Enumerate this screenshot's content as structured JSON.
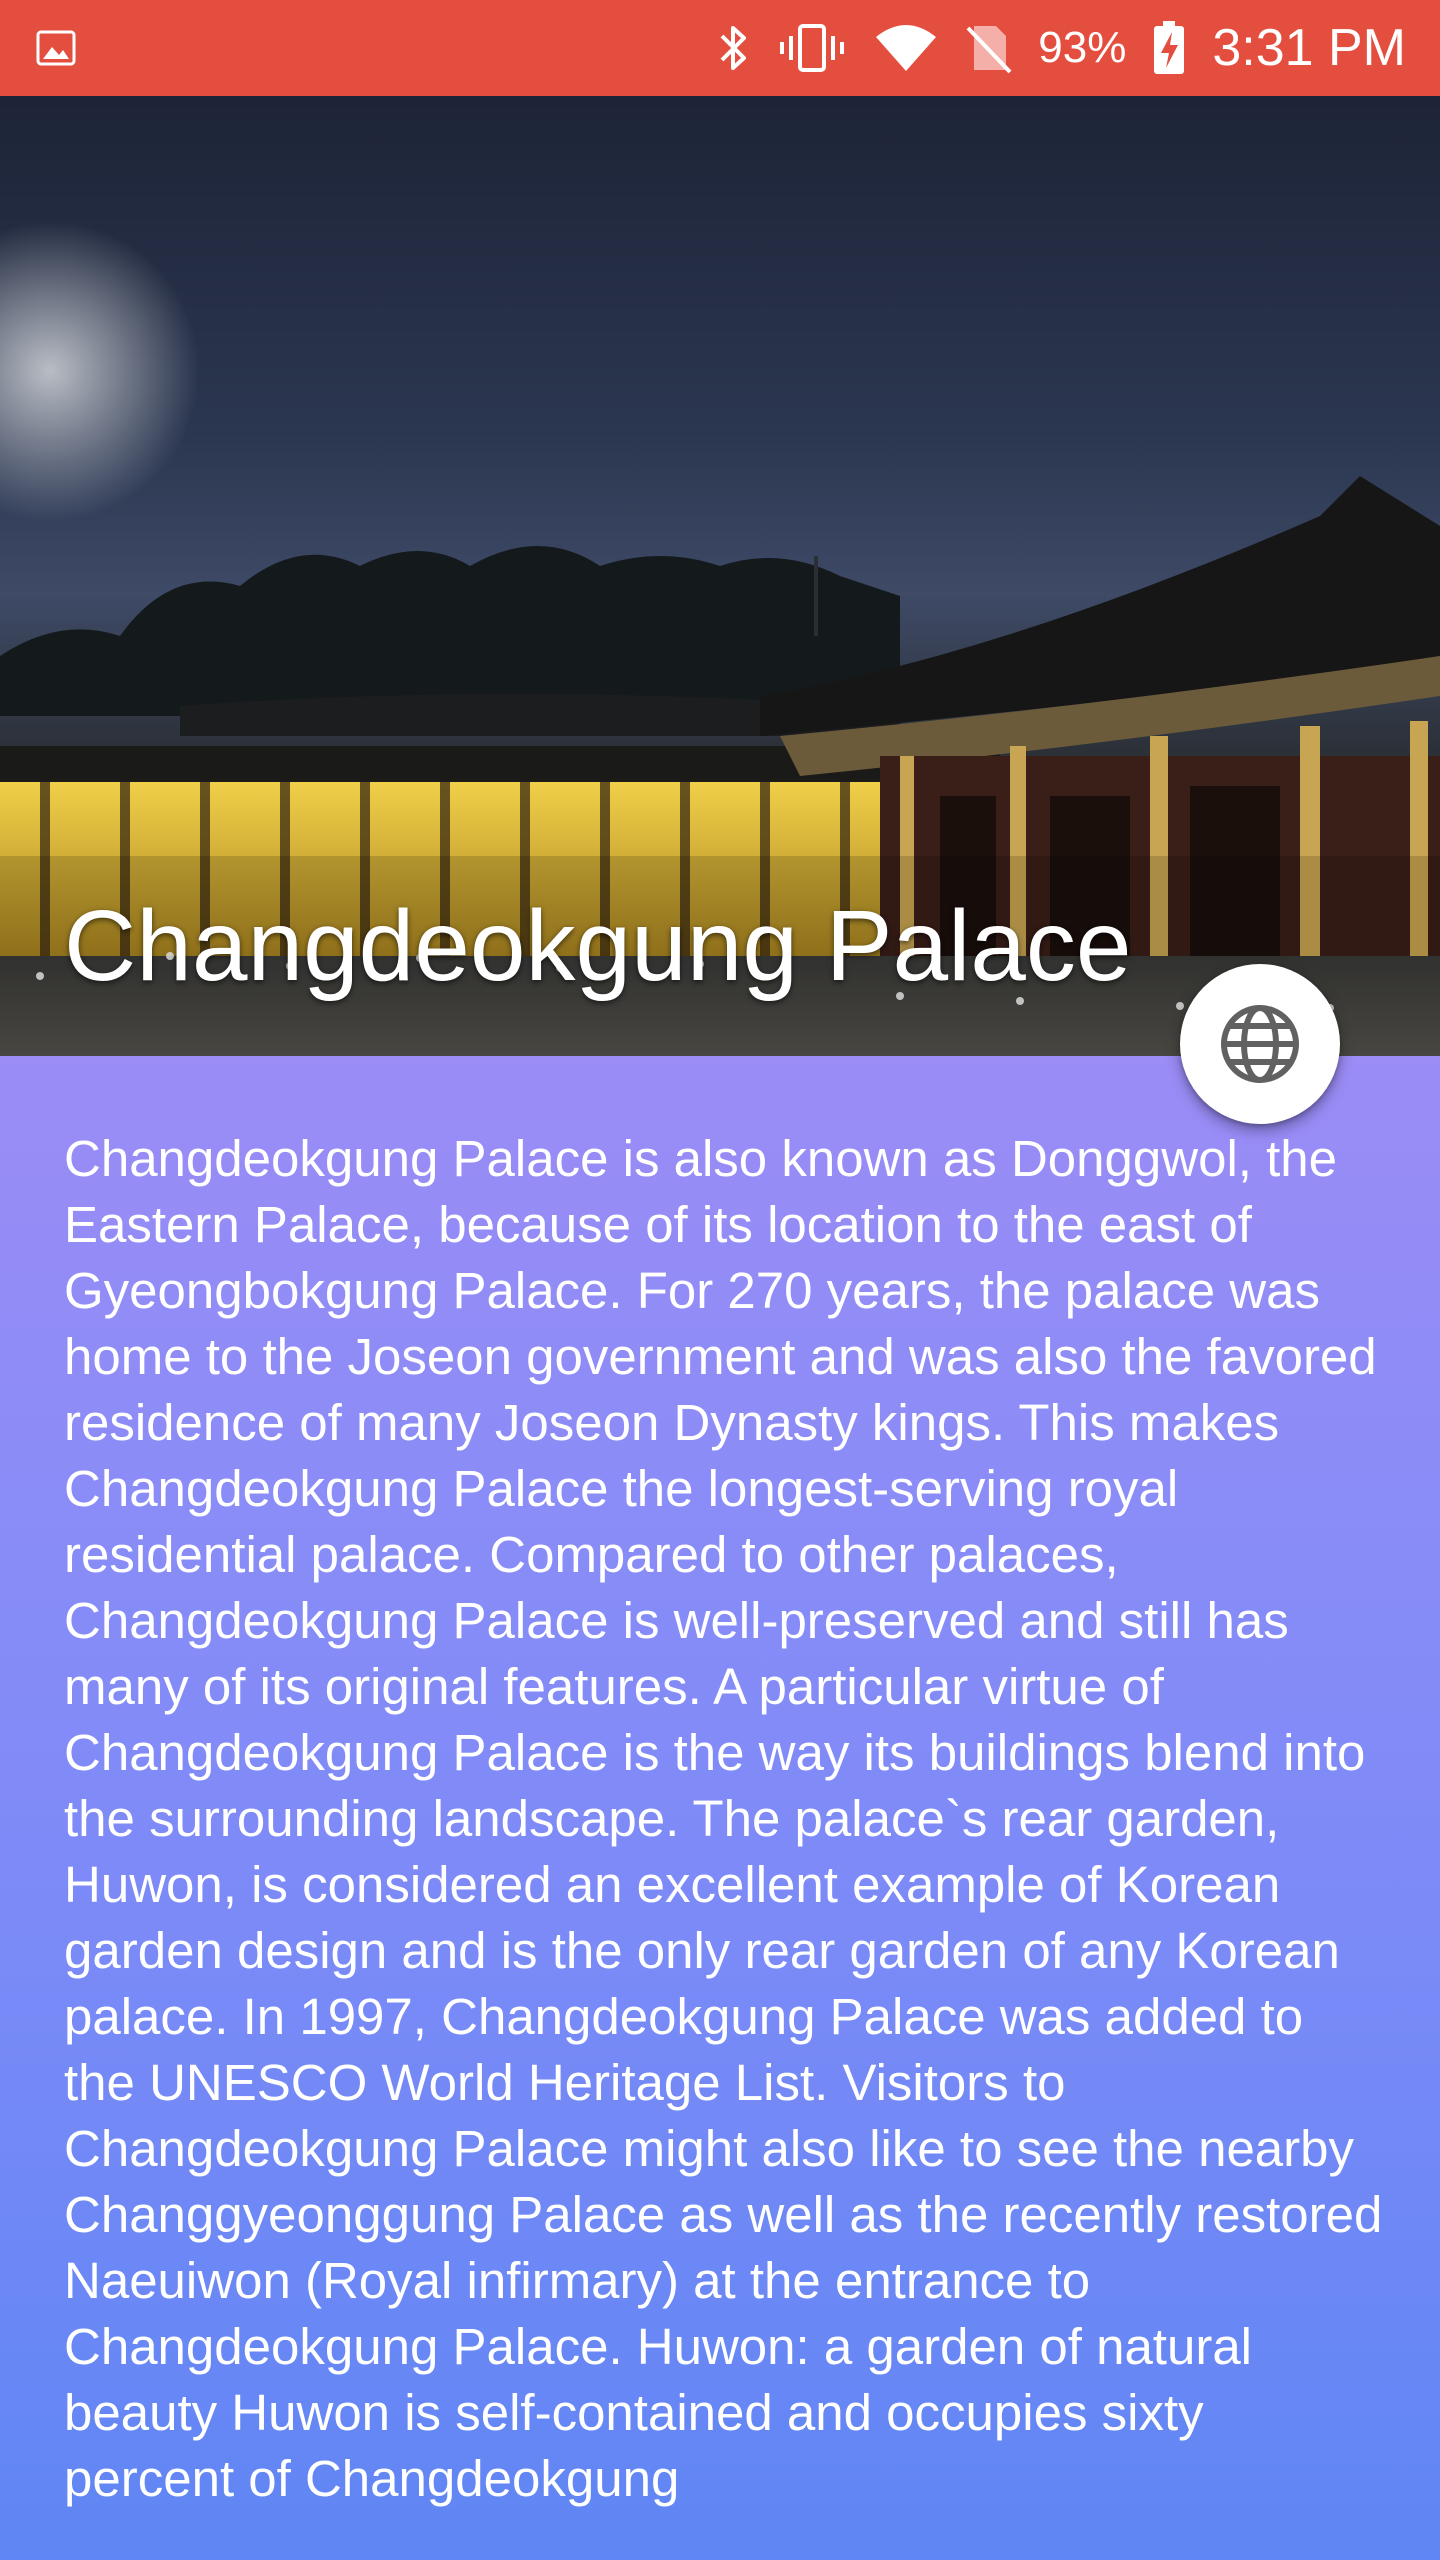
{
  "status_bar": {
    "battery_percent": "93%",
    "time": "3:31 PM",
    "icons": [
      "image-icon",
      "bluetooth-icon",
      "vibrate-icon",
      "wifi-icon",
      "no-sim-icon",
      "battery-charging-icon"
    ]
  },
  "hero": {
    "title": "Changdeokgung Palace"
  },
  "fab": {
    "icon": "globe-icon"
  },
  "description": "Changdeokgung Palace is also known as Donggwol, the Eastern Palace, because of its location to the east of Gyeongbokgung Palace. For 270 years, the palace was home to the Joseon government and was also the favored residence of many Joseon Dynasty kings. This makes Changdeokgung Palace the longest-serving royal residential palace. Compared to other palaces, Changdeokgung Palace is well-preserved and still has many of its original features. A particular virtue of Changdeokgung Palace is the way its buildings blend into the surrounding landscape. The palace`s rear garden, Huwon, is considered an excellent example of Korean garden design and is the only rear garden of any Korean palace. In 1997, Changdeokgung Palace was added to the UNESCO World Heritage List. Visitors to Changdeokgung Palace might also like to see the nearby Changgyeonggung Palace as well as the recently restored Naeuiwon (Royal infirmary) at the entrance to Changdeokgung Palace.   Huwon: a garden of natural beauty   Huwon is self-contained and occupies sixty percent of Changdeokgung",
  "colors": {
    "status_bar": "#e44e3f",
    "content_top": "#9b8cf6",
    "content_bottom": "#5f86f4"
  }
}
